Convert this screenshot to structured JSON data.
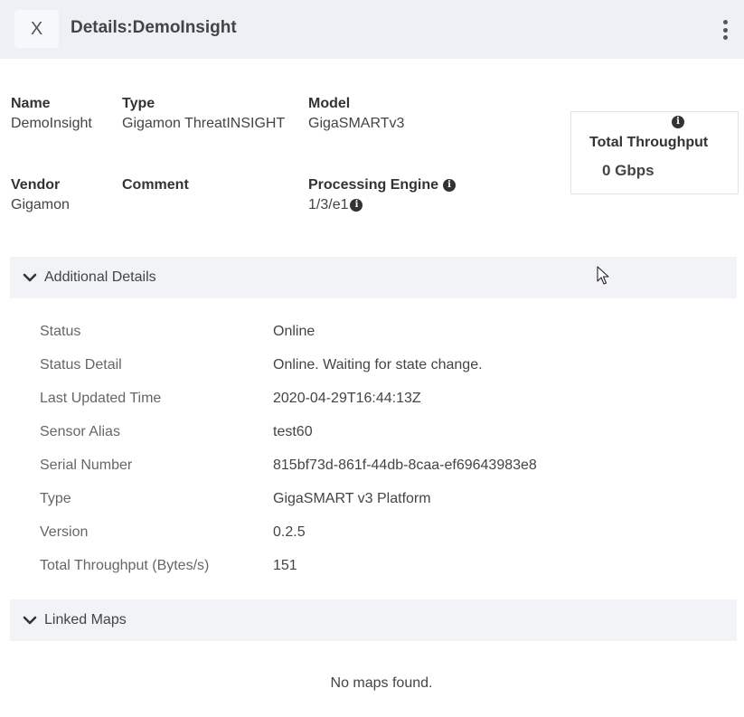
{
  "header": {
    "close_label": "X",
    "title": "Details:DemoInsight",
    "more_icon": "kebab-vertical-icon"
  },
  "summary": {
    "name": {
      "label": "Name",
      "value": "DemoInsight"
    },
    "type": {
      "label": "Type",
      "value": "Gigamon ThreatINSIGHT"
    },
    "model": {
      "label": "Model",
      "value": "GigaSMARTv3"
    },
    "vendor": {
      "label": "Vendor",
      "value": "Gigamon"
    },
    "comment": {
      "label": "Comment",
      "value": ""
    },
    "processing_engine": {
      "label": "Processing Engine",
      "value": "1/3/e1"
    }
  },
  "throughput_card": {
    "label": "Total Throughput",
    "value": "0 Gbps"
  },
  "additional_details": {
    "title": "Additional Details",
    "rows": [
      {
        "label": "Status",
        "value": "Online"
      },
      {
        "label": "Status Detail",
        "value": "Online. Waiting for state change."
      },
      {
        "label": "Last Updated Time",
        "value": "2020-04-29T16:44:13Z"
      },
      {
        "label": "Sensor Alias",
        "value": "test60"
      },
      {
        "label": "Serial Number",
        "value": "815bf73d-861f-44db-8caa-ef69643983e8"
      },
      {
        "label": "Type",
        "value": "GigaSMART v3 Platform"
      },
      {
        "label": "Version",
        "value": "0.2.5"
      },
      {
        "label": "Total Throughput (Bytes/s)",
        "value": "151"
      }
    ]
  },
  "linked_maps": {
    "title": "Linked Maps",
    "empty_text": "No maps found."
  },
  "colors": {
    "header_bg": "#eef0f5",
    "section_bg": "#f2f3f6",
    "text": "#333333",
    "muted_text": "#666666"
  }
}
